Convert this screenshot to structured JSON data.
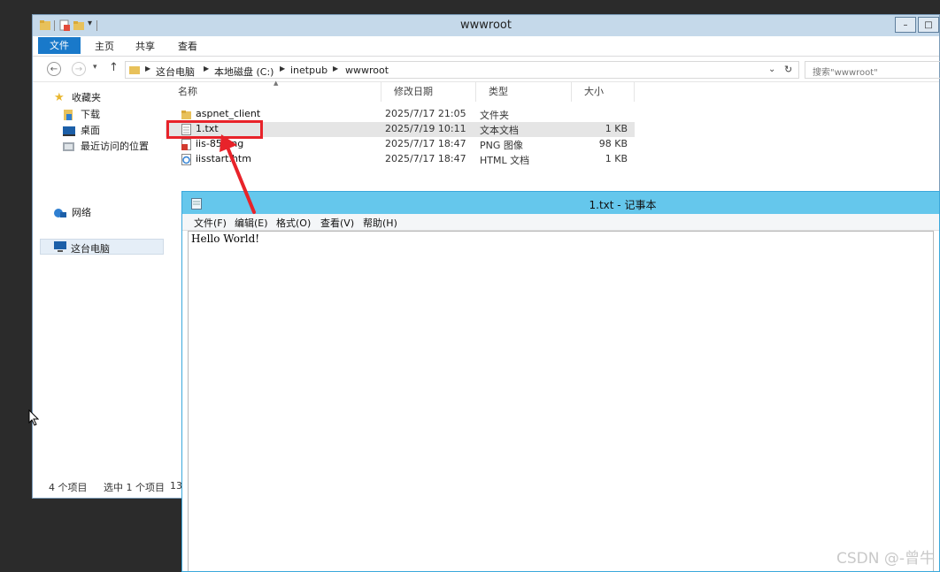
{
  "explorer": {
    "title": "wwwroot",
    "window_buttons": [
      "–",
      "□"
    ],
    "ribbon": {
      "file": "文件",
      "tabs": [
        "主页",
        "共享",
        "查看"
      ]
    },
    "address": {
      "crumbs": [
        "这台电脑",
        "本地磁盘 (C:)",
        "inetpub",
        "wwwroot"
      ]
    },
    "search": {
      "placeholder": "搜索\"wwwroot\""
    },
    "sidebar": {
      "favorites": "收藏夹",
      "fav_items": [
        "下载",
        "桌面",
        "最近访问的位置"
      ],
      "this_pc": "这台电脑",
      "network": "网络"
    },
    "columns": [
      "名称",
      "修改日期",
      "类型",
      "大小"
    ],
    "files": [
      {
        "name": "aspnet_client",
        "date": "2025/7/17 21:05",
        "type": "文件夹",
        "size": ""
      },
      {
        "name": "1.txt",
        "date": "2025/7/19 10:11",
        "type": "文本文档",
        "size": "1 KB"
      },
      {
        "name": "iis-85.png",
        "date": "2025/7/17 18:47",
        "type": "PNG 图像",
        "size": "98 KB"
      },
      {
        "name": "iisstart.htm",
        "date": "2025/7/17 18:47",
        "type": "HTML 文档",
        "size": "1 KB"
      }
    ],
    "status": {
      "count": "4 个项目",
      "selected": "选中 1 个项目",
      "extra": "13"
    }
  },
  "notepad": {
    "title": "1.txt - 记事本",
    "menu": [
      "文件(F)",
      "编辑(E)",
      "格式(O)",
      "查看(V)",
      "帮助(H)"
    ],
    "content": "Hello World!"
  },
  "watermark": "CSDN @-曾牛",
  "colors": {
    "annotation": "#e8232a",
    "notepad_title": "#65c7ec",
    "file_tab": "#1979ca"
  }
}
